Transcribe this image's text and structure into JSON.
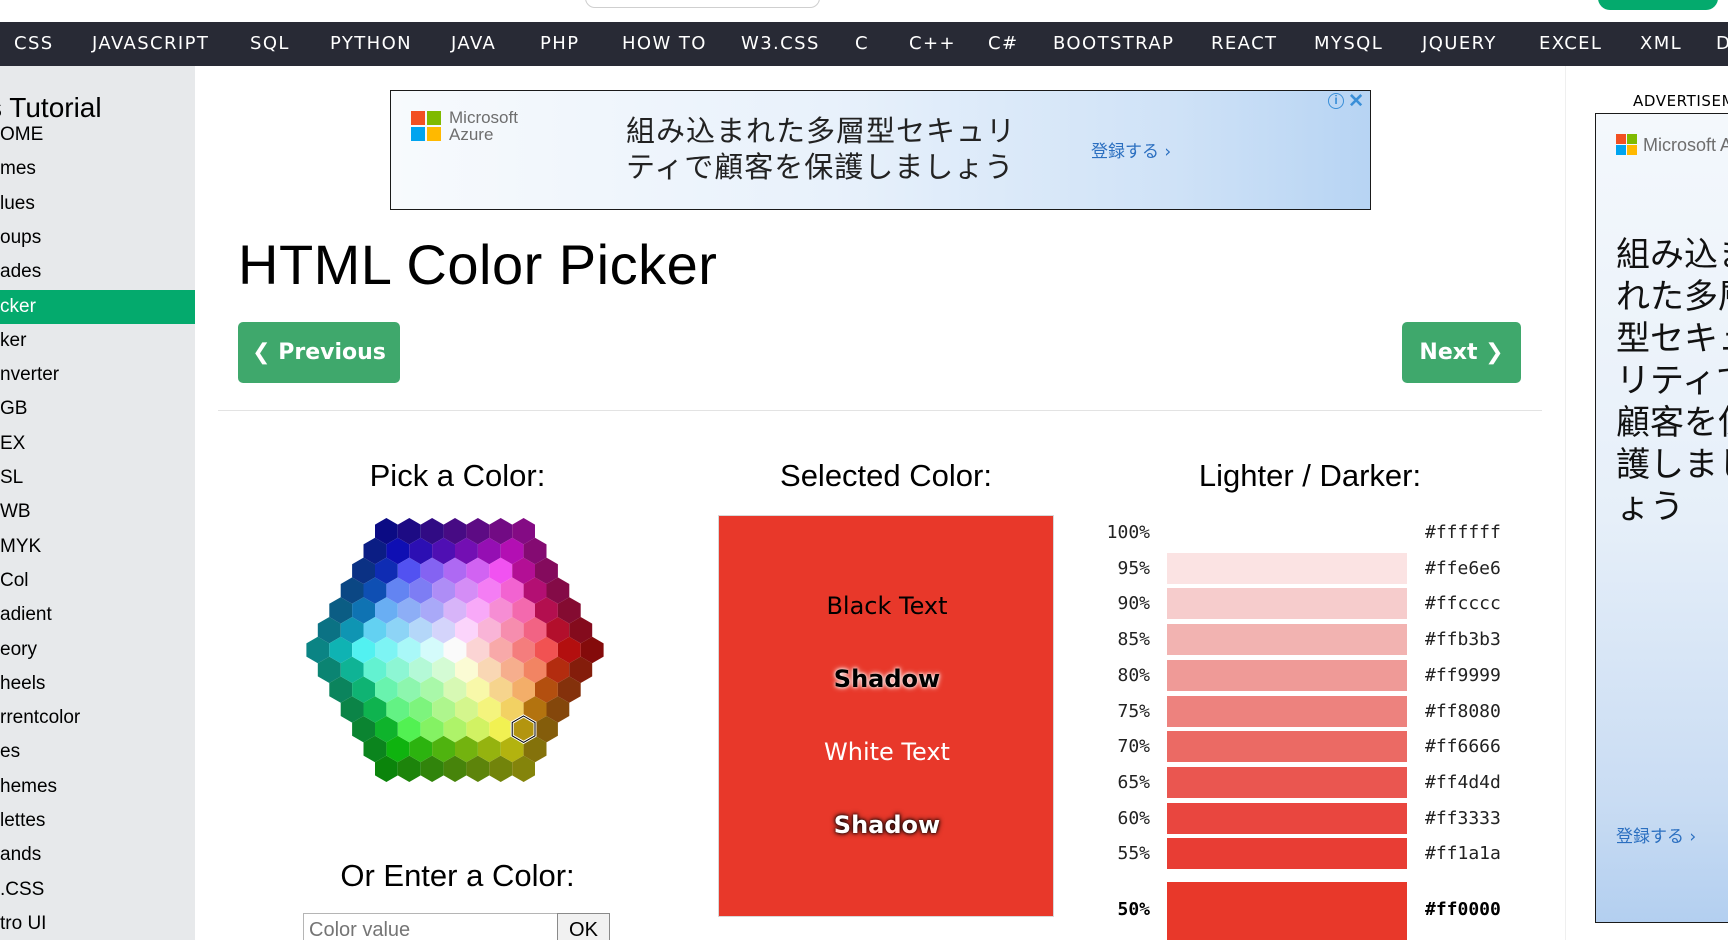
{
  "nav": {
    "items": [
      "CSS",
      "JAVASCRIPT",
      "SQL",
      "PYTHON",
      "JAVA",
      "PHP",
      "HOW TO",
      "W3.CSS",
      "C",
      "C++",
      "C#",
      "BOOTSTRAP",
      "REACT",
      "MYSQL",
      "JQUERY",
      "EXCEL",
      "XML",
      "D"
    ]
  },
  "sidebar": {
    "title": "s Tutorial",
    "items": [
      "OME",
      "mes",
      "lues",
      "oups",
      "ades",
      "cker",
      "ker",
      "nverter",
      "GB",
      "EX",
      "SL",
      "WB",
      "MYK",
      "Col",
      "adient",
      "eory",
      "heels",
      "rrentcolor",
      "es",
      "hemes",
      "lettes",
      "ands",
      ".CSS",
      "tro UI"
    ],
    "active_index": 5
  },
  "ad_banner": {
    "brand_line1": "Microsoft",
    "brand_line2": "Azure",
    "text": "組み込まれた多層型セキュリティで顧客を保護しましょう",
    "cta": "登録する ›",
    "info": "i",
    "close": "✕"
  },
  "page": {
    "title": "HTML Color Picker",
    "prev_label": "❮ Previous",
    "next_label": "Next ❯"
  },
  "picker": {
    "pick_heading": "Pick a Color:",
    "enter_heading": "Or Enter a Color:",
    "input_placeholder": "Color value",
    "ok_label": "OK"
  },
  "selected": {
    "heading": "Selected Color:",
    "color": "#e8382a",
    "black_text": "Black Text",
    "shadow1": "Shadow",
    "white_text": "White Text",
    "shadow2": "Shadow"
  },
  "shades": {
    "heading": "Lighter / Darker:",
    "rows": [
      {
        "pct": "100%",
        "hex": "#ffffff",
        "color": "#ffffff"
      },
      {
        "pct": "95%",
        "hex": "#ffe6e6",
        "color": "#fbe3e3"
      },
      {
        "pct": "90%",
        "hex": "#ffcccc",
        "color": "#f6cccc"
      },
      {
        "pct": "85%",
        "hex": "#ffb3b3",
        "color": "#f2b3b1"
      },
      {
        "pct": "80%",
        "hex": "#ff9999",
        "color": "#ef9a97"
      },
      {
        "pct": "75%",
        "hex": "#ff8080",
        "color": "#ed827e"
      },
      {
        "pct": "70%",
        "hex": "#ff6666",
        "color": "#eb6a64"
      },
      {
        "pct": "65%",
        "hex": "#ff4d4d",
        "color": "#ea5650"
      },
      {
        "pct": "60%",
        "hex": "#ff3333",
        "color": "#e9463f"
      },
      {
        "pct": "55%",
        "hex": "#ff1a1a",
        "color": "#e83d34"
      },
      {
        "pct": "50%",
        "hex": "#ff0000",
        "color": "#e8382a"
      }
    ]
  },
  "right_ad": {
    "label": "ADVERTISEMENT",
    "brand": "Microsoft A",
    "text": "組み込まれた多層型セキュリティで顧客を保護しましょう",
    "cta": "登録する ›"
  }
}
